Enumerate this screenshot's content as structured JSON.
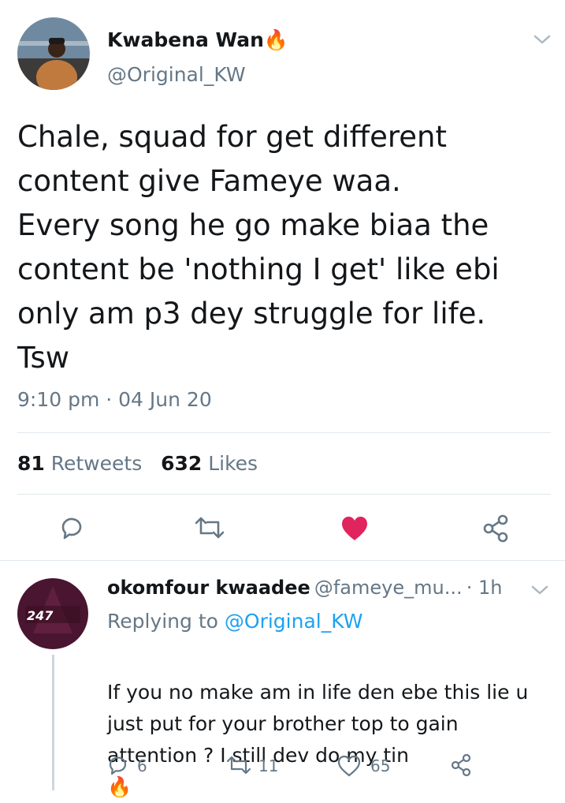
{
  "tweet": {
    "author_name": "Kwabena Wan",
    "author_emoji": "🔥",
    "author_handle": "@Original_KW",
    "text": "Chale, squad for get different\ncontent give Fameye waa.\nEvery song he go make biaa the\ncontent be 'nothing I get' like ebi\nonly am p3 dey struggle for life.\nTsw",
    "time": "9:10 pm · 04 Jun 20",
    "retweets_count": "81",
    "retweets_label": "Retweets",
    "likes_count": "632",
    "likes_label": "Likes"
  },
  "reply": {
    "author_name": "okomfour kwaadee",
    "author_handle": "@fameye_mu...",
    "time": "· 1h",
    "avatar_text": "247",
    "replying_prefix": "Replying to",
    "replying_to": "@Original_KW",
    "text": "If you no make am in life den ebe this lie u\njust put for your brother top to gain\nattention ? I still dev do my tin",
    "text_emoji": "🔥",
    "reply_count": "6",
    "retweet_count": "11",
    "like_count": "65"
  },
  "colors": {
    "like_active": "#e0245e",
    "link": "#1da1f2",
    "secondary_text": "#657786"
  }
}
